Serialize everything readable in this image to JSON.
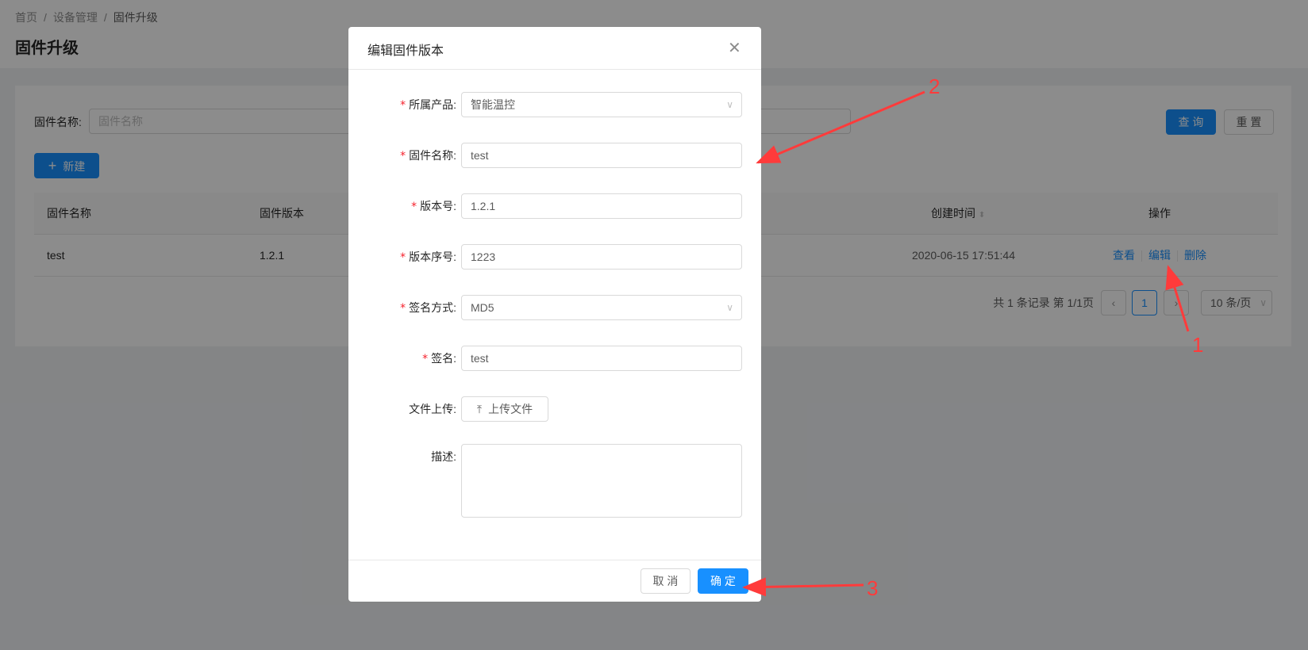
{
  "breadcrumb": [
    "首页",
    "设备管理",
    "固件升级"
  ],
  "page_title": "固件升级",
  "search": {
    "label": "固件名称:",
    "placeholder": "固件名称",
    "query": "查 询",
    "reset": "重 置"
  },
  "new_button": "新建",
  "table": {
    "columns": [
      "固件名称",
      "固件版本",
      "创建时间",
      "操作"
    ],
    "rows": [
      {
        "name": "test",
        "version": "1.2.1",
        "created": "2020-06-15 17:51:44",
        "actions": [
          "查看",
          "编辑",
          "删除"
        ]
      }
    ]
  },
  "pagination": {
    "summary": "共 1 条记录 第 1/1页",
    "current": "1",
    "page_size": "10 条/页"
  },
  "modal": {
    "title": "编辑固件版本",
    "fields": [
      {
        "label": "所属产品:",
        "value": "智能温控",
        "required": true,
        "type": "select"
      },
      {
        "label": "固件名称:",
        "value": "test",
        "required": true,
        "type": "input"
      },
      {
        "label": "版本号:",
        "value": "1.2.1",
        "required": true,
        "type": "input"
      },
      {
        "label": "版本序号:",
        "value": "1223",
        "required": true,
        "type": "input"
      },
      {
        "label": "签名方式:",
        "value": "MD5",
        "required": true,
        "type": "select"
      },
      {
        "label": "签名:",
        "value": "test",
        "required": true,
        "type": "input"
      },
      {
        "label": "文件上传:",
        "button": "上传文件",
        "required": false,
        "type": "upload"
      },
      {
        "label": "描述:",
        "value": "",
        "required": false,
        "type": "textarea"
      }
    ],
    "cancel": "取 消",
    "ok": "确 定"
  },
  "annotations": [
    "1",
    "2",
    "3"
  ],
  "colors": {
    "primary": "#1890ff",
    "annotation": "#ff3b3b",
    "required": "#f5222d"
  }
}
